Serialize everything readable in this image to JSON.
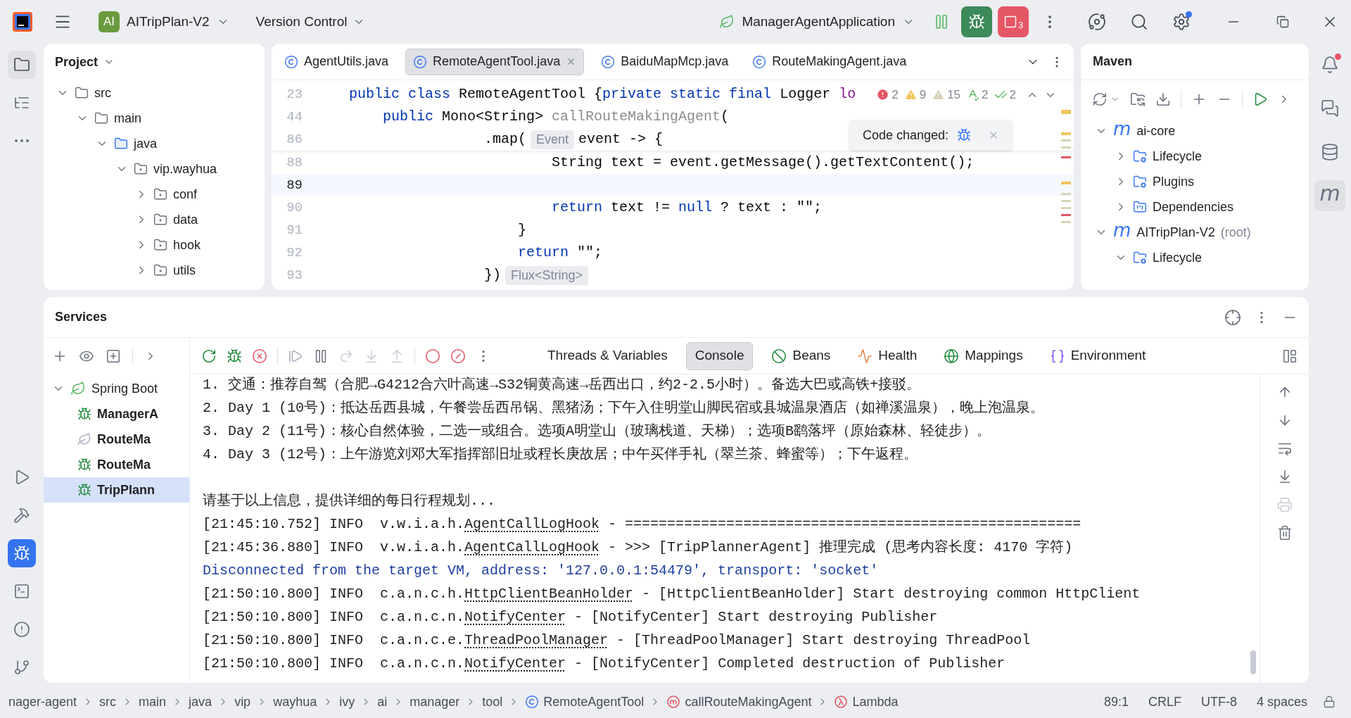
{
  "title_bar": {
    "project_badge": "AI",
    "project": "AITripPlan-V2",
    "vcs": "Version Control",
    "run_config": "ManagerAgentApplication",
    "stop_count": "3"
  },
  "left_toolbar": {
    "top": [
      {
        "kind": "project",
        "selected": true
      },
      {
        "kind": "structure",
        "selected": false
      },
      {
        "kind": "more",
        "selected": false
      }
    ],
    "bottom": [
      {
        "kind": "run",
        "selected": false
      },
      {
        "kind": "build",
        "selected": false
      },
      {
        "kind": "services",
        "selected": true
      },
      {
        "kind": "terminal",
        "selected": false
      },
      {
        "kind": "problems",
        "selected": false
      },
      {
        "kind": "git",
        "selected": false
      }
    ]
  },
  "project_panel": {
    "title": "Project",
    "tree": [
      {
        "label": "src",
        "kind": "folder",
        "expanded": true,
        "children": [
          {
            "label": "main",
            "kind": "folder",
            "expanded": true,
            "children": [
              {
                "label": "java",
                "kind": "source",
                "expanded": true,
                "children": [
                  {
                    "label": "vip.wayhua",
                    "kind": "package",
                    "expanded": true,
                    "children": [
                      {
                        "label": "conf",
                        "kind": "package",
                        "expanded": false
                      },
                      {
                        "label": "data",
                        "kind": "package",
                        "expanded": false
                      },
                      {
                        "label": "hook",
                        "kind": "package",
                        "expanded": false
                      },
                      {
                        "label": "utils",
                        "kind": "package",
                        "expanded": false
                      }
                    ]
                  }
                ]
              }
            ]
          }
        ]
      }
    ]
  },
  "editor": {
    "tabs": [
      {
        "label": "AgentUtils.java",
        "selected": false
      },
      {
        "label": "RemoteAgentTool.java",
        "selected": true
      },
      {
        "label": "BaiduMapMcp.java",
        "selected": false
      },
      {
        "label": "RouteMakingAgent.java",
        "selected": false
      }
    ],
    "lines": [
      {
        "number": "23",
        "sticky": true,
        "current": false,
        "tokens": [
          {
            "kind": "keyword",
            "text": "public class "
          },
          {
            "kind": "plain",
            "text": "RemoteAgentTool {"
          },
          {
            "kind": "keyword",
            "text": "private static final "
          },
          {
            "kind": "plain",
            "text": "Logger "
          },
          {
            "kind": "field",
            "text": "lo"
          }
        ]
      },
      {
        "number": "44",
        "sticky": true,
        "current": false,
        "tokens": [
          {
            "kind": "keyword",
            "text": "    public "
          },
          {
            "kind": "plain",
            "text": "Mono<String> "
          },
          {
            "kind": "muted",
            "text": "callRouteMakingAgent"
          },
          {
            "kind": "plain",
            "text": "("
          }
        ]
      },
      {
        "number": "86",
        "sticky": true,
        "current": false,
        "tokens": [
          {
            "kind": "plain",
            "text": "                .map("
          },
          {
            "kind": "hint",
            "text": "Event"
          },
          {
            "kind": "plain",
            "text": "event -> {"
          }
        ]
      },
      {
        "number": "88",
        "sticky": false,
        "current": false,
        "tokens": [
          {
            "kind": "plain",
            "text": "                        String text = event.getMessage().getTextContent();"
          }
        ]
      },
      {
        "number": "89",
        "sticky": false,
        "current": true
      },
      {
        "number": "90",
        "sticky": false,
        "current": false,
        "tokens": [
          {
            "kind": "keyword",
            "text": "                        return "
          },
          {
            "kind": "plain",
            "text": "text != "
          },
          {
            "kind": "keyword",
            "text": "null"
          },
          {
            "kind": "plain",
            "text": " ? text : \"\";"
          }
        ]
      },
      {
        "number": "91",
        "sticky": false,
        "current": false,
        "tokens": [
          {
            "kind": "plain",
            "text": "                    }"
          }
        ]
      },
      {
        "number": "92",
        "sticky": false,
        "current": false,
        "tokens": [
          {
            "kind": "keyword",
            "text": "                    return "
          },
          {
            "kind": "plain",
            "text": "\"\";"
          }
        ]
      },
      {
        "number": "93",
        "sticky": false,
        "current": false,
        "tokens": [
          {
            "kind": "plain",
            "text": "                })"
          },
          {
            "kind": "hint",
            "text": "Flux<String>"
          }
        ]
      }
    ],
    "inspections": [
      {
        "kind": "error",
        "count": "2"
      },
      {
        "kind": "warning",
        "count": "9"
      },
      {
        "kind": "weak",
        "count": "15"
      },
      {
        "kind": "typo",
        "count": "2"
      },
      {
        "kind": "ok",
        "count": "2"
      }
    ],
    "popup": {
      "text": "Code changed:"
    }
  },
  "maven": {
    "title": "Maven",
    "tree": [
      {
        "label": "ai-core",
        "kind": "module",
        "glyph": "m",
        "expanded": true,
        "children": [
          {
            "label": "Lifecycle",
            "kind": "lifecycle",
            "expanded": false
          },
          {
            "label": "Plugins",
            "kind": "plugins",
            "expanded": false
          },
          {
            "label": "Dependencies",
            "kind": "dependencies",
            "expanded": false
          }
        ]
      },
      {
        "label": "AITripPlan-V2",
        "suffix": "(root)",
        "kind": "module",
        "glyph": "m",
        "expanded": true,
        "children": [
          {
            "label": "Lifecycle",
            "kind": "lifecycle",
            "expanded": true
          }
        ]
      }
    ]
  },
  "right_toolbar": [
    {
      "kind": "notifications",
      "badge": true,
      "selected": false
    },
    {
      "kind": "ai-chat",
      "badge": false,
      "selected": false
    },
    {
      "kind": "database",
      "badge": false,
      "selected": false
    },
    {
      "kind": "maven",
      "glyph": "m",
      "badge": false,
      "selected": true
    }
  ],
  "services": {
    "title": "Services",
    "tree": [
      {
        "label": "Spring Boot",
        "expanded": true,
        "children": [
          {
            "label": "ManagerA",
            "running": true,
            "selected": false
          },
          {
            "label": "RouteMa",
            "running": false,
            "selected": false
          },
          {
            "label": "RouteMa",
            "running": true,
            "selected": false
          },
          {
            "label": "TripPlann",
            "running": true,
            "selected": true
          }
        ]
      }
    ],
    "tabs": [
      {
        "label": "Threads & Variables",
        "kind": "threads",
        "selected": false
      },
      {
        "label": "Console",
        "kind": "console",
        "selected": true
      },
      {
        "label": "Beans",
        "kind": "beans",
        "selected": false
      },
      {
        "label": "Health",
        "kind": "health",
        "selected": false
      },
      {
        "label": "Mappings",
        "kind": "mappings",
        "selected": false
      },
      {
        "label": "Environment",
        "kind": "environment",
        "selected": false
      }
    ],
    "console": [
      {
        "kind": "plain",
        "text": "1. 交通：推荐自驾（合肥→G4212合六叶高速→S32铜黄高速→岳西出口，约2-2.5小时）。备选大巴或高铁+接驳。"
      },
      {
        "kind": "plain",
        "text": "2. Day 1 (10号)：抵达岳西县城，午餐尝岳西吊锅、黑猪汤；下午入住明堂山脚民宿或县城温泉酒店（如禅溪温泉），晚上泡温泉。"
      },
      {
        "kind": "plain",
        "text": "3. Day 2 (11号)：核心自然体验，二选一或组合。选项A明堂山（玻璃栈道、天梯）；选项B鹞落坪（原始森林、轻徒步）。"
      },
      {
        "kind": "plain",
        "text": "4. Day 3 (12号)：上午游览刘邓大军指挥部旧址或程长庚故居；中午买伴手礼（翠兰茶、蜂蜜等）；下午返程。"
      },
      {
        "kind": "plain",
        "gap_before": true,
        "text": "请基于以上信息，提供详细的每日行程规划..."
      },
      {
        "kind": "log",
        "prefix": "[21:45:10.752] INFO  v.w.i.a.h.",
        "link": "AgentCallLogHook",
        "rest": " - ======================================================"
      },
      {
        "kind": "log",
        "prefix": "[21:45:36.880] INFO  v.w.i.a.h.",
        "link": "AgentCallLogHook",
        "rest": " - >>> [TripPlannerAgent] 推理完成 (思考内容长度: 4170 字符)"
      },
      {
        "kind": "system",
        "text": "Disconnected from the target VM, address: '127.0.0.1:54479', transport: 'socket'"
      },
      {
        "kind": "log",
        "prefix": "[21:50:10.800] INFO  c.a.n.c.h.",
        "link": "HttpClientBeanHolder",
        "rest": " - [HttpClientBeanHolder] Start destroying common HttpClient"
      },
      {
        "kind": "log",
        "prefix": "[21:50:10.800] INFO  c.a.n.c.n.",
        "link": "NotifyCenter",
        "rest": " - [NotifyCenter] Start destroying Publisher"
      },
      {
        "kind": "log",
        "prefix": "[21:50:10.800] INFO  c.a.n.c.e.",
        "link": "ThreadPoolManager",
        "rest": " - [ThreadPoolManager] Start destroying ThreadPool"
      },
      {
        "kind": "log",
        "prefix": "[21:50:10.800] INFO  c.a.n.c.n.",
        "link": "NotifyCenter",
        "rest": " - [NotifyCenter] Completed destruction of Publisher"
      }
    ]
  },
  "status_bar": {
    "breadcrumbs": [
      {
        "label": "nager-agent",
        "kind": "folder"
      },
      {
        "label": "src",
        "kind": "folder"
      },
      {
        "label": "main",
        "kind": "folder"
      },
      {
        "label": "java",
        "kind": "folder"
      },
      {
        "label": "vip",
        "kind": "folder"
      },
      {
        "label": "wayhua",
        "kind": "folder"
      },
      {
        "label": "ivy",
        "kind": "folder"
      },
      {
        "label": "ai",
        "kind": "folder"
      },
      {
        "label": "manager",
        "kind": "folder"
      },
      {
        "label": "tool",
        "kind": "folder"
      },
      {
        "label": "RemoteAgentTool",
        "kind": "class"
      },
      {
        "label": "callRouteMakingAgent",
        "kind": "method"
      },
      {
        "label": "Lambda",
        "kind": "lambda"
      }
    ],
    "position": "89:1",
    "line_ending": "CRLF",
    "encoding": "UTF-8",
    "indent": "4 spaces"
  }
}
